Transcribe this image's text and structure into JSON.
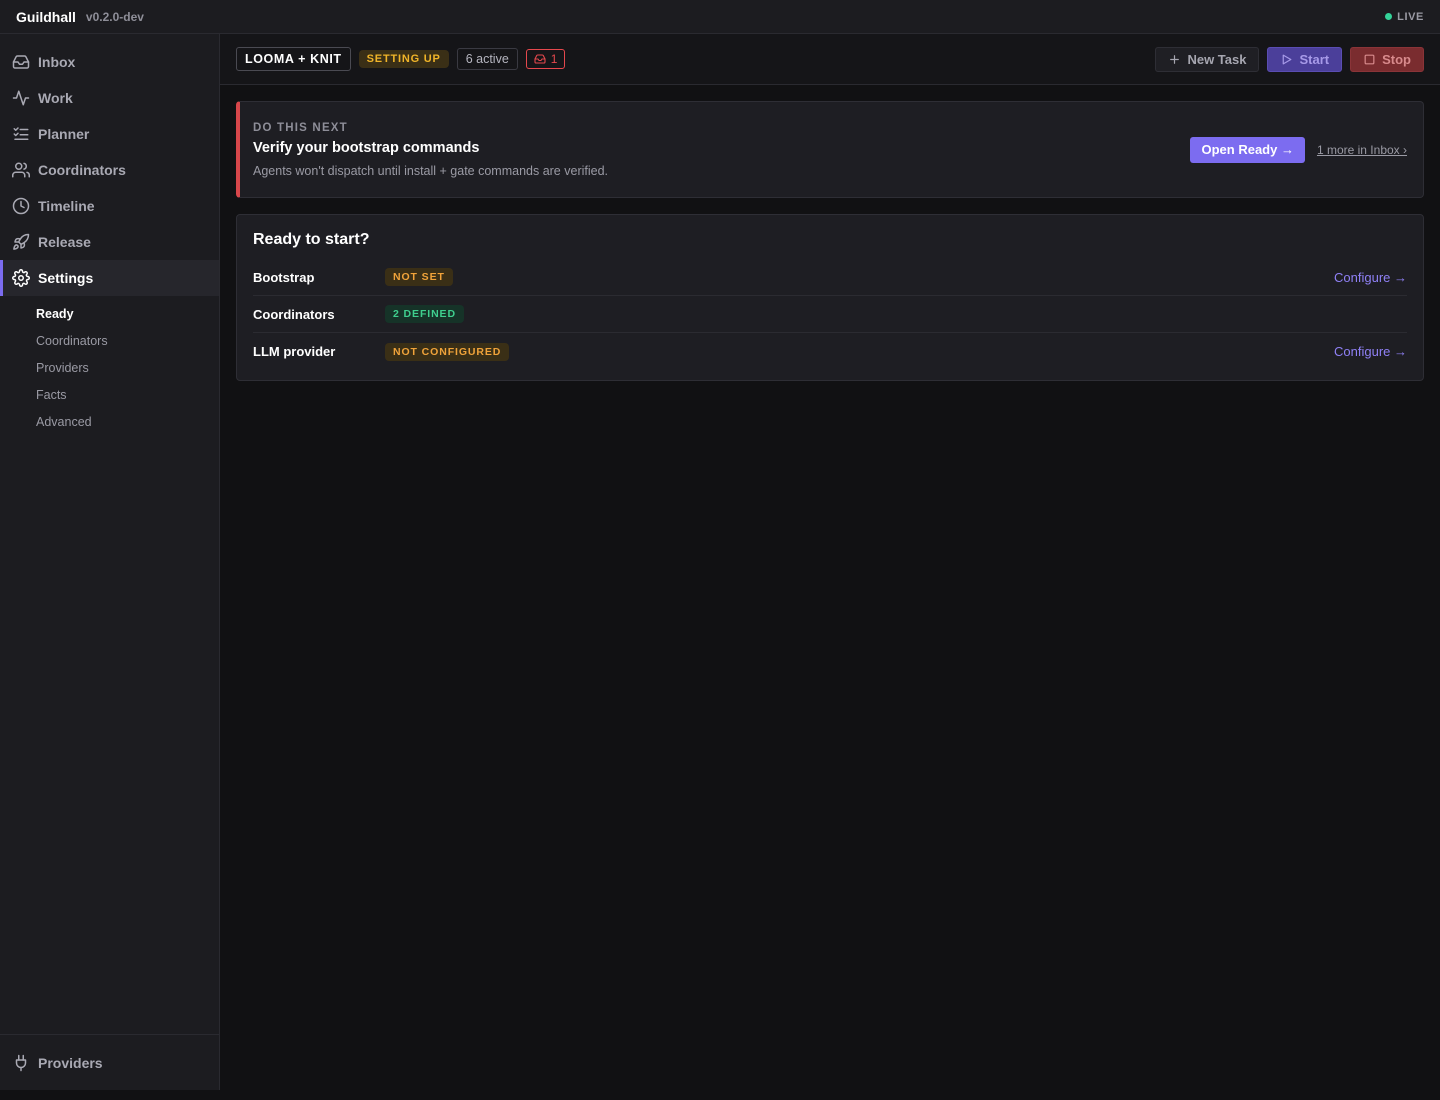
{
  "app": {
    "name": "Guildhall",
    "version": "v0.2.0-dev",
    "live_label": "LIVE"
  },
  "colors": {
    "accent": "#7c6cf0",
    "danger": "#e5484d",
    "warning": "#f0b429",
    "success": "#3fcf8e"
  },
  "sidebar": {
    "items": [
      {
        "label": "Inbox",
        "icon": "inbox-icon"
      },
      {
        "label": "Work",
        "icon": "activity-icon"
      },
      {
        "label": "Planner",
        "icon": "checklist-icon"
      },
      {
        "label": "Coordinators",
        "icon": "users-icon"
      },
      {
        "label": "Timeline",
        "icon": "clock-icon"
      },
      {
        "label": "Release",
        "icon": "rocket-icon"
      },
      {
        "label": "Settings",
        "icon": "gear-icon",
        "active": true
      }
    ],
    "subitems": [
      {
        "label": "Ready",
        "active": true
      },
      {
        "label": "Coordinators"
      },
      {
        "label": "Providers"
      },
      {
        "label": "Facts"
      },
      {
        "label": "Advanced"
      }
    ],
    "footer": {
      "label": "Providers",
      "icon": "plug-icon"
    }
  },
  "header": {
    "project": "LOOMA + KNIT",
    "status": "SETTING UP",
    "active_count": "6 active",
    "inbox_count": "1",
    "new_task": "New Task",
    "start": "Start",
    "stop": "Stop"
  },
  "next": {
    "eyebrow": "DO THIS NEXT",
    "title": "Verify your bootstrap commands",
    "description": "Agents won't dispatch until install + gate commands are verified.",
    "cta": "Open Ready →",
    "more": "1 more in Inbox ›"
  },
  "ready": {
    "title": "Ready to start?",
    "rows": [
      {
        "label": "Bootstrap",
        "badge": "NOT SET",
        "action": "Configure →"
      },
      {
        "label": "Coordinators",
        "badge": "2 DEFINED",
        "action": ""
      },
      {
        "label": "LLM provider",
        "badge": "NOT CONFIGURED",
        "action": "Configure →"
      }
    ]
  }
}
